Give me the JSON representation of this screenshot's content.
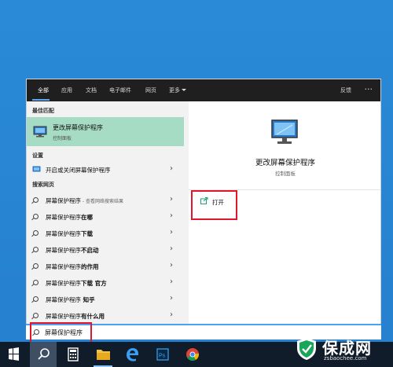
{
  "tabs": [
    "全部",
    "应用",
    "文档",
    "电子邮件",
    "网页",
    "更多"
  ],
  "header": {
    "feedback": "反馈",
    "more_options": "···"
  },
  "sections": {
    "best": "最佳匹配",
    "settings": "设置",
    "web": "搜索网页"
  },
  "best_match": {
    "title": "更改屏幕保护程序",
    "subtitle": "控制面板"
  },
  "settings_item": "开启或关闭屏幕保护程序",
  "web_results": [
    {
      "query": "屏幕保护程序",
      "suffix": "",
      "hint": " - 查看网络搜索结果"
    },
    {
      "query": "屏幕保护程序",
      "suffix": "在哪",
      "hint": ""
    },
    {
      "query": "屏幕保护程序",
      "suffix": "下载",
      "hint": ""
    },
    {
      "query": "屏幕保护程序",
      "suffix": "不启动",
      "hint": ""
    },
    {
      "query": "屏幕保护程序",
      "suffix": "的作用",
      "hint": ""
    },
    {
      "query": "屏幕保护程序",
      "suffix": "下载 官方",
      "hint": ""
    },
    {
      "query": "屏幕保护程序",
      "suffix": " 知乎",
      "hint": ""
    },
    {
      "query": "屏幕保护程序",
      "suffix": "有什么用",
      "hint": ""
    }
  ],
  "preview": {
    "title": "更改屏幕保护程序",
    "subtitle": "控制面板",
    "action_open": "打开"
  },
  "search": {
    "value": "屏幕保护程序"
  },
  "watermark": {
    "name": "保成网",
    "url": "zsbaochee.com"
  },
  "colors": {
    "highlight": "#a7dcc4",
    "annotation": "#e2162b",
    "desktop": "#2a8ad8",
    "taskbar": "#101c2a"
  }
}
